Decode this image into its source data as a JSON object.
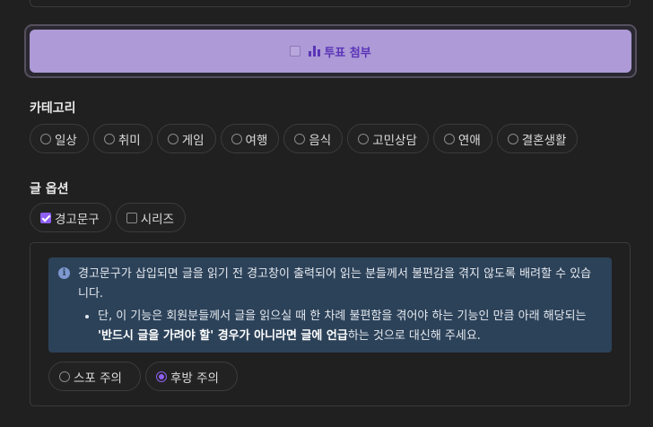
{
  "poll": {
    "label": "투표 첨부"
  },
  "category": {
    "title": "카테고리",
    "items": [
      "일상",
      "취미",
      "게임",
      "여행",
      "음식",
      "고민상담",
      "연애",
      "결혼생활"
    ]
  },
  "post_options": {
    "title": "글 옵션",
    "items": [
      {
        "label": "경고문구",
        "checked": true
      },
      {
        "label": "시리즈",
        "checked": false
      }
    ]
  },
  "info": {
    "main_text": "경고문구가 삽입되면 글을 읽기 전 경고창이 출력되어 읽는 분들께서 불편감을 겪지 않도록 배려할 수 있습니다.",
    "bullet_pre": "단, 이 기능은 회원분들께서 글을 읽으실 때 한 차례 불편함을 겪어야 하는 기능인 만큼 아래 해당되는 ",
    "bullet_bold1": "'반드시 글을 가려야 할' 경우가 아니라면 글에 언급",
    "bullet_post": "하는 것으로 대신해 주세요."
  },
  "warning_types": [
    {
      "label": "스포 주의",
      "selected": false
    },
    {
      "label": "후방 주의",
      "selected": true
    }
  ],
  "colors": {
    "accent": "#8f5ff2",
    "poll_bg": "#ad9ad6",
    "info_bg": "#2c4259"
  }
}
